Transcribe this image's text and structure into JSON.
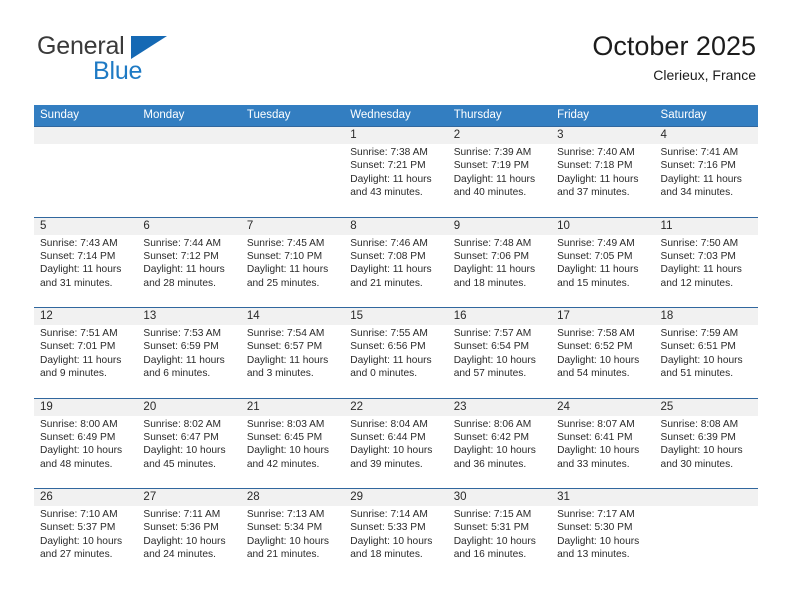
{
  "brand": {
    "line1": "General",
    "line2": "Blue",
    "accent_color": "#1569b4"
  },
  "header": {
    "title": "October 2025",
    "subtitle": "Clerieux, France"
  },
  "calendar": {
    "header_bg": "#337ec1",
    "daynum_bg": "#f1f1f1",
    "weekdays": [
      "Sunday",
      "Monday",
      "Tuesday",
      "Wednesday",
      "Thursday",
      "Friday",
      "Saturday"
    ],
    "labels": {
      "sunrise": "Sunrise:",
      "sunset": "Sunset:",
      "daylight": "Daylight:"
    },
    "weeks": [
      [
        {
          "day": "",
          "sunrise": "",
          "sunset": "",
          "daylight_1": "",
          "daylight_2": ""
        },
        {
          "day": "",
          "sunrise": "",
          "sunset": "",
          "daylight_1": "",
          "daylight_2": ""
        },
        {
          "day": "",
          "sunrise": "",
          "sunset": "",
          "daylight_1": "",
          "daylight_2": ""
        },
        {
          "day": "1",
          "sunrise": "Sunrise: 7:38 AM",
          "sunset": "Sunset: 7:21 PM",
          "daylight_1": "Daylight: 11 hours",
          "daylight_2": "and 43 minutes."
        },
        {
          "day": "2",
          "sunrise": "Sunrise: 7:39 AM",
          "sunset": "Sunset: 7:19 PM",
          "daylight_1": "Daylight: 11 hours",
          "daylight_2": "and 40 minutes."
        },
        {
          "day": "3",
          "sunrise": "Sunrise: 7:40 AM",
          "sunset": "Sunset: 7:18 PM",
          "daylight_1": "Daylight: 11 hours",
          "daylight_2": "and 37 minutes."
        },
        {
          "day": "4",
          "sunrise": "Sunrise: 7:41 AM",
          "sunset": "Sunset: 7:16 PM",
          "daylight_1": "Daylight: 11 hours",
          "daylight_2": "and 34 minutes."
        }
      ],
      [
        {
          "day": "5",
          "sunrise": "Sunrise: 7:43 AM",
          "sunset": "Sunset: 7:14 PM",
          "daylight_1": "Daylight: 11 hours",
          "daylight_2": "and 31 minutes."
        },
        {
          "day": "6",
          "sunrise": "Sunrise: 7:44 AM",
          "sunset": "Sunset: 7:12 PM",
          "daylight_1": "Daylight: 11 hours",
          "daylight_2": "and 28 minutes."
        },
        {
          "day": "7",
          "sunrise": "Sunrise: 7:45 AM",
          "sunset": "Sunset: 7:10 PM",
          "daylight_1": "Daylight: 11 hours",
          "daylight_2": "and 25 minutes."
        },
        {
          "day": "8",
          "sunrise": "Sunrise: 7:46 AM",
          "sunset": "Sunset: 7:08 PM",
          "daylight_1": "Daylight: 11 hours",
          "daylight_2": "and 21 minutes."
        },
        {
          "day": "9",
          "sunrise": "Sunrise: 7:48 AM",
          "sunset": "Sunset: 7:06 PM",
          "daylight_1": "Daylight: 11 hours",
          "daylight_2": "and 18 minutes."
        },
        {
          "day": "10",
          "sunrise": "Sunrise: 7:49 AM",
          "sunset": "Sunset: 7:05 PM",
          "daylight_1": "Daylight: 11 hours",
          "daylight_2": "and 15 minutes."
        },
        {
          "day": "11",
          "sunrise": "Sunrise: 7:50 AM",
          "sunset": "Sunset: 7:03 PM",
          "daylight_1": "Daylight: 11 hours",
          "daylight_2": "and 12 minutes."
        }
      ],
      [
        {
          "day": "12",
          "sunrise": "Sunrise: 7:51 AM",
          "sunset": "Sunset: 7:01 PM",
          "daylight_1": "Daylight: 11 hours",
          "daylight_2": "and 9 minutes."
        },
        {
          "day": "13",
          "sunrise": "Sunrise: 7:53 AM",
          "sunset": "Sunset: 6:59 PM",
          "daylight_1": "Daylight: 11 hours",
          "daylight_2": "and 6 minutes."
        },
        {
          "day": "14",
          "sunrise": "Sunrise: 7:54 AM",
          "sunset": "Sunset: 6:57 PM",
          "daylight_1": "Daylight: 11 hours",
          "daylight_2": "and 3 minutes."
        },
        {
          "day": "15",
          "sunrise": "Sunrise: 7:55 AM",
          "sunset": "Sunset: 6:56 PM",
          "daylight_1": "Daylight: 11 hours",
          "daylight_2": "and 0 minutes."
        },
        {
          "day": "16",
          "sunrise": "Sunrise: 7:57 AM",
          "sunset": "Sunset: 6:54 PM",
          "daylight_1": "Daylight: 10 hours",
          "daylight_2": "and 57 minutes."
        },
        {
          "day": "17",
          "sunrise": "Sunrise: 7:58 AM",
          "sunset": "Sunset: 6:52 PM",
          "daylight_1": "Daylight: 10 hours",
          "daylight_2": "and 54 minutes."
        },
        {
          "day": "18",
          "sunrise": "Sunrise: 7:59 AM",
          "sunset": "Sunset: 6:51 PM",
          "daylight_1": "Daylight: 10 hours",
          "daylight_2": "and 51 minutes."
        }
      ],
      [
        {
          "day": "19",
          "sunrise": "Sunrise: 8:00 AM",
          "sunset": "Sunset: 6:49 PM",
          "daylight_1": "Daylight: 10 hours",
          "daylight_2": "and 48 minutes."
        },
        {
          "day": "20",
          "sunrise": "Sunrise: 8:02 AM",
          "sunset": "Sunset: 6:47 PM",
          "daylight_1": "Daylight: 10 hours",
          "daylight_2": "and 45 minutes."
        },
        {
          "day": "21",
          "sunrise": "Sunrise: 8:03 AM",
          "sunset": "Sunset: 6:45 PM",
          "daylight_1": "Daylight: 10 hours",
          "daylight_2": "and 42 minutes."
        },
        {
          "day": "22",
          "sunrise": "Sunrise: 8:04 AM",
          "sunset": "Sunset: 6:44 PM",
          "daylight_1": "Daylight: 10 hours",
          "daylight_2": "and 39 minutes."
        },
        {
          "day": "23",
          "sunrise": "Sunrise: 8:06 AM",
          "sunset": "Sunset: 6:42 PM",
          "daylight_1": "Daylight: 10 hours",
          "daylight_2": "and 36 minutes."
        },
        {
          "day": "24",
          "sunrise": "Sunrise: 8:07 AM",
          "sunset": "Sunset: 6:41 PM",
          "daylight_1": "Daylight: 10 hours",
          "daylight_2": "and 33 minutes."
        },
        {
          "day": "25",
          "sunrise": "Sunrise: 8:08 AM",
          "sunset": "Sunset: 6:39 PM",
          "daylight_1": "Daylight: 10 hours",
          "daylight_2": "and 30 minutes."
        }
      ],
      [
        {
          "day": "26",
          "sunrise": "Sunrise: 7:10 AM",
          "sunset": "Sunset: 5:37 PM",
          "daylight_1": "Daylight: 10 hours",
          "daylight_2": "and 27 minutes."
        },
        {
          "day": "27",
          "sunrise": "Sunrise: 7:11 AM",
          "sunset": "Sunset: 5:36 PM",
          "daylight_1": "Daylight: 10 hours",
          "daylight_2": "and 24 minutes."
        },
        {
          "day": "28",
          "sunrise": "Sunrise: 7:13 AM",
          "sunset": "Sunset: 5:34 PM",
          "daylight_1": "Daylight: 10 hours",
          "daylight_2": "and 21 minutes."
        },
        {
          "day": "29",
          "sunrise": "Sunrise: 7:14 AM",
          "sunset": "Sunset: 5:33 PM",
          "daylight_1": "Daylight: 10 hours",
          "daylight_2": "and 18 minutes."
        },
        {
          "day": "30",
          "sunrise": "Sunrise: 7:15 AM",
          "sunset": "Sunset: 5:31 PM",
          "daylight_1": "Daylight: 10 hours",
          "daylight_2": "and 16 minutes."
        },
        {
          "day": "31",
          "sunrise": "Sunrise: 7:17 AM",
          "sunset": "Sunset: 5:30 PM",
          "daylight_1": "Daylight: 10 hours",
          "daylight_2": "and 13 minutes."
        },
        {
          "day": "",
          "sunrise": "",
          "sunset": "",
          "daylight_1": "",
          "daylight_2": ""
        }
      ]
    ]
  }
}
